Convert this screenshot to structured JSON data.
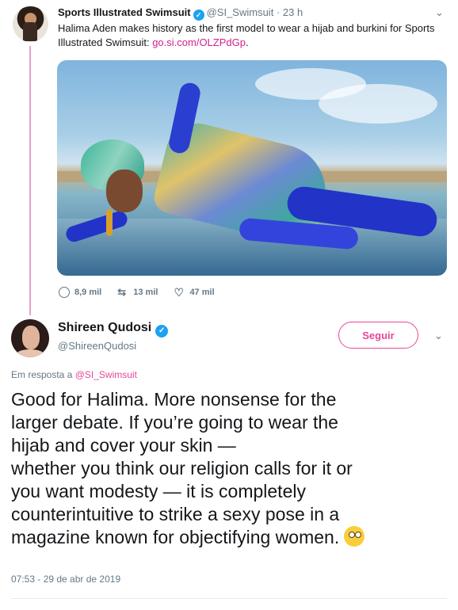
{
  "tweet1": {
    "display_name": "Sports Illustrated Swimsuit",
    "handle": "@SI_Swimsuit",
    "time": "· 23 h",
    "text_before_link": "Halima Aden makes history as the first model to wear a hijab and burkini for Sports Illustrated Swimsuit: ",
    "link": "go.si.com/OLZPdGp",
    "text_after_link": ".",
    "stats": {
      "replies": "8,9 mil",
      "retweets": "13 mil",
      "likes": "47 mil"
    },
    "icons": {
      "reply": "reply-icon",
      "retweet": "retweet-icon",
      "like": "heart-icon",
      "menu": "chevron-down-icon"
    }
  },
  "tweet2": {
    "display_name": "Shireen Qudosi",
    "handle": "@ShireenQudosi",
    "follow_label": "Seguir",
    "replying_prefix": "Em resposta a",
    "replying_to": "@SI_Swimsuit",
    "text": "Good for Halima. More nonsense for the\nlarger debate. If you’re going to wear the\nhijab and cover your skin —\nwhether you think our religion calls for it or\nyou want modesty — it is completely\ncounterintuitive to strike a sexy pose in a\nmagazine known for objectifying women.",
    "emoji": "face-with-rolling-eyes",
    "timestamp": "07:53 - 29 de abr de 2019"
  },
  "colors": {
    "accent": "#e8479a",
    "verified": "#1da1f2",
    "muted": "#657786",
    "thread_line": "#e8a0c8"
  }
}
